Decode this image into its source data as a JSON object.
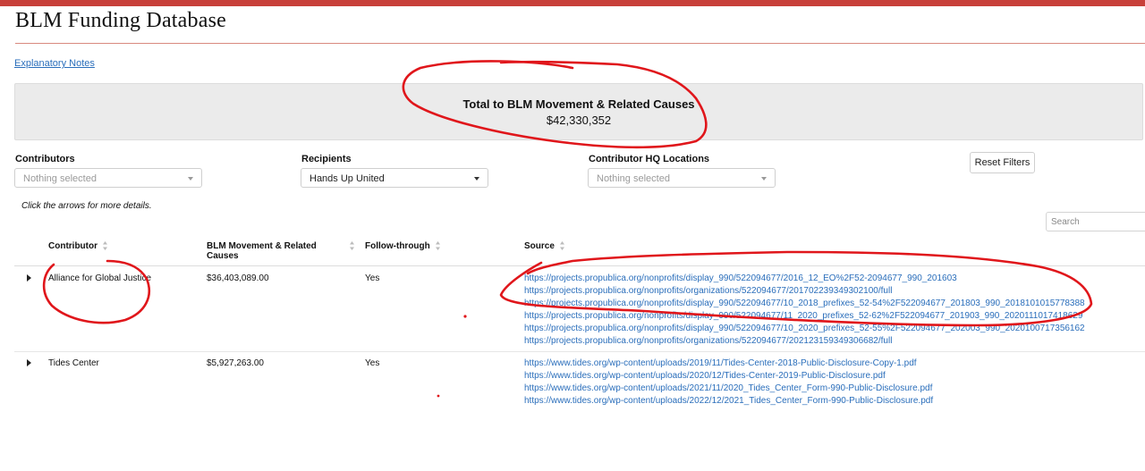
{
  "site": {
    "title": "BLM Funding Database"
  },
  "notes_link": "Explanatory Notes",
  "total": {
    "title": "Total to BLM Movement & Related Causes",
    "value": "$42,330,352"
  },
  "filters": {
    "contributors": {
      "label": "Contributors",
      "value": "Nothing selected"
    },
    "recipients": {
      "label": "Recipients",
      "value": "Hands Up United"
    },
    "locations": {
      "label": "Contributor HQ Locations",
      "value": "Nothing selected"
    },
    "reset_label": "Reset Filters"
  },
  "hint": "Click the arrows for more details.",
  "search": {
    "placeholder": "Search"
  },
  "table": {
    "headers": {
      "contributor": "Contributor",
      "amount_line1": "BLM Movement & Related",
      "amount_line2": "Causes",
      "follow": "Follow-through",
      "source": "Source"
    },
    "rows": [
      {
        "contributor": "Alliance for Global Justice",
        "amount": "$36,403,089.00",
        "follow": "Yes",
        "sources": [
          "https://projects.propublica.org/nonprofits/display_990/522094677/2016_12_EO%2F52-2094677_990_201603",
          "https://projects.propublica.org/nonprofits/organizations/522094677/201702239349302100/full",
          "https://projects.propublica.org/nonprofits/display_990/522094677/10_2018_prefixes_52-54%2F522094677_201803_990_2018101015778388",
          "https://projects.propublica.org/nonprofits/display_990/522094677/11_2020_prefixes_52-62%2F522094677_201903_990_2020111017418629",
          "https://projects.propublica.org/nonprofits/display_990/522094677/10_2020_prefixes_52-55%2F522094677_202003_990_2020100717356162",
          "https://projects.propublica.org/nonprofits/organizations/522094677/202123159349306682/full"
        ]
      },
      {
        "contributor": "Tides Center",
        "amount": "$5,927,263.00",
        "follow": "Yes",
        "sources": [
          "https://www.tides.org/wp-content/uploads/2019/11/Tides-Center-2018-Public-Disclosure-Copy-1.pdf",
          "https://www.tides.org/wp-content/uploads/2020/12/Tides-Center-2019-Public-Disclosure.pdf",
          "https://www.tides.org/wp-content/uploads/2021/11/2020_Tides_Center_Form-990-Public-Disclosure.pdf",
          "https://www.tides.org/wp-content/uploads/2022/12/2021_Tides_Center_Form-990-Public-Disclosure.pdf"
        ]
      }
    ]
  },
  "colors": {
    "accent": "#c8403a",
    "link": "#2a6ebb",
    "annotation": "#e0161b"
  }
}
